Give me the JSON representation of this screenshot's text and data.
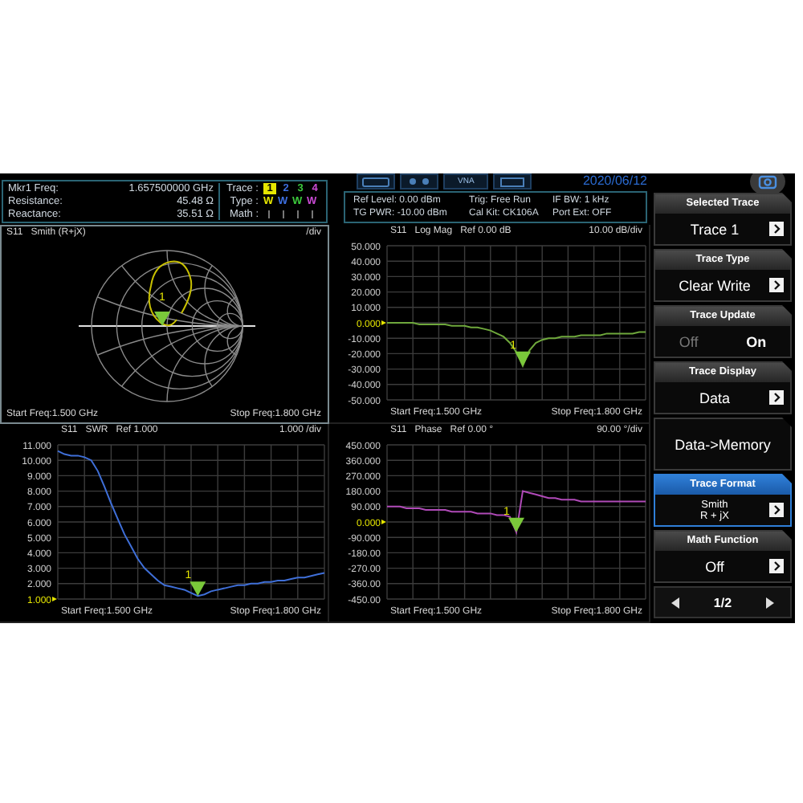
{
  "top_bar": {
    "mode": "VNA",
    "date": "2020/06/12"
  },
  "marker_info": [
    {
      "label": "Mkr1 Freq:",
      "value": "1.657500000 GHz"
    },
    {
      "label": "Resistance:",
      "value": "45.48 Ω"
    },
    {
      "label": "Reactance:",
      "value": "35.51 Ω"
    }
  ],
  "trace_info": {
    "trace_label": "Trace :",
    "type_label": "Type :",
    "math_label": "Math :",
    "traces": [
      {
        "number": "1",
        "type": "W",
        "color": "#e6e600",
        "selected": true
      },
      {
        "number": "2",
        "type": "W",
        "color": "#3d6fe0",
        "selected": false
      },
      {
        "number": "3",
        "type": "W",
        "color": "#3cc83c",
        "selected": false
      },
      {
        "number": "4",
        "type": "W",
        "color": "#c84ad2",
        "selected": false
      }
    ]
  },
  "settings": [
    "Ref Level: 0.00 dBm",
    "Trig: Free Run",
    "IF BW: 1 kHz",
    "TG PWR: -10.00 dBm",
    "Cal Kit: CK106A",
    "Port Ext: OFF"
  ],
  "panels": [
    {
      "kind": "smith",
      "parameter": "S11",
      "format": "Smith (R+jX)",
      "scale": "/div",
      "marker": "1",
      "start": "Start Freq:1.500 GHz",
      "stop": "Stop Freq:1.800 GHz"
    },
    {
      "kind": "line",
      "format": "Log Mag",
      "ref": "Ref 0.00 dB",
      "scale": "10.00  dB/div",
      "marker": "1",
      "ref_at_bottom": false,
      "start": "Start Freq:1.500 GHz",
      "stop": "Stop Freq:1.800 GHz",
      "chart_data": {
        "type": "line",
        "ylim": [
          -50,
          50
        ],
        "grid": true,
        "categories": [
          null,
          null,
          null,
          null,
          null,
          null,
          null,
          null,
          null,
          null,
          null,
          null,
          null,
          null,
          null,
          null,
          null,
          null,
          null,
          null,
          null,
          null,
          null,
          null,
          null,
          null,
          null,
          null,
          null,
          null,
          null,
          null,
          null,
          null,
          null,
          null,
          null,
          null,
          null,
          null,
          null
        ],
        "yticks": [
          {
            "value": 50,
            "label": "50.000"
          },
          {
            "value": 40,
            "label": "40.000"
          },
          {
            "value": 30,
            "label": "30.000"
          },
          {
            "value": 20,
            "label": "20.000"
          },
          {
            "value": 10,
            "label": "10.000"
          },
          {
            "value": 0,
            "label": "0.000"
          },
          {
            "value": -10,
            "label": "-10.000"
          },
          {
            "value": -20,
            "label": "-20.000"
          },
          {
            "value": -30,
            "label": "-30.000"
          },
          {
            "value": -40,
            "label": "-40.000"
          },
          {
            "value": -50,
            "label": "-50.000"
          }
        ],
        "series": [
          {
            "name": "S11",
            "color": "#6fa83c",
            "values": [
              0,
              0,
              0,
              0,
              0,
              -1,
              -1,
              -1,
              -1,
              -1,
              -2,
              -2,
              -2,
              -3,
              -3,
              -4,
              -5,
              -7,
              -9,
              -13,
              -19,
              -28,
              -18,
              -13,
              -11,
              -10,
              -10,
              -9,
              -9,
              -9,
              -8,
              -8,
              -8,
              -8,
              -7,
              -7,
              -7,
              -7,
              -7,
              -6,
              -6
            ]
          }
        ]
      }
    },
    {
      "kind": "line",
      "format": "SWR",
      "ref": "Ref 1.000",
      "scale": "1.000  /div",
      "marker": "1",
      "ref_at_bottom": true,
      "start": "Start Freq:1.500 GHz",
      "stop": "Stop Freq:1.800 GHz",
      "chart_data": {
        "type": "line",
        "ylim": [
          1,
          11
        ],
        "grid": true,
        "categories": [
          null,
          null,
          null,
          null,
          null,
          null,
          null,
          null,
          null,
          null,
          null,
          null,
          null,
          null,
          null,
          null,
          null,
          null,
          null,
          null,
          null,
          null,
          null,
          null,
          null,
          null,
          null,
          null,
          null,
          null,
          null,
          null,
          null,
          null,
          null,
          null,
          null,
          null,
          null,
          null,
          null
        ],
        "yticks": [
          {
            "value": 11,
            "label": "11.000"
          },
          {
            "value": 10,
            "label": "10.000"
          },
          {
            "value": 9,
            "label": "9.000"
          },
          {
            "value": 8,
            "label": "8.000"
          },
          {
            "value": 7,
            "label": "7.000"
          },
          {
            "value": 6,
            "label": "6.000"
          },
          {
            "value": 5,
            "label": "5.000"
          },
          {
            "value": 4,
            "label": "4.000"
          },
          {
            "value": 3,
            "label": "3.000"
          },
          {
            "value": 2,
            "label": "2.000"
          },
          {
            "value": 1,
            "label": "1.000"
          }
        ],
        "series": [
          {
            "name": "S11",
            "color": "#3f6fd8",
            "values": [
              10.6,
              10.4,
              10.3,
              10.3,
              10.2,
              10,
              9.3,
              8.3,
              7.2,
              6.2,
              5.2,
              4.4,
              3.6,
              3,
              2.6,
              2.2,
              1.9,
              1.8,
              1.7,
              1.6,
              1.4,
              1.2,
              1.3,
              1.5,
              1.6,
              1.7,
              1.8,
              1.9,
              1.9,
              2,
              2,
              2.1,
              2.1,
              2.2,
              2.2,
              2.3,
              2.4,
              2.4,
              2.5,
              2.6,
              2.7
            ]
          }
        ]
      }
    },
    {
      "kind": "line",
      "format": "Phase",
      "ref": "Ref 0.00 °",
      "scale": "90.00  °/div",
      "marker": "1",
      "ref_at_bottom": false,
      "start": "Start Freq:1.500 GHz",
      "stop": "Stop Freq:1.800 GHz",
      "chart_data": {
        "type": "line",
        "ylim": [
          -450,
          450
        ],
        "grid": true,
        "categories": [
          null,
          null,
          null,
          null,
          null,
          null,
          null,
          null,
          null,
          null,
          null,
          null,
          null,
          null,
          null,
          null,
          null,
          null,
          null,
          null,
          null,
          null,
          null,
          null,
          null,
          null,
          null,
          null,
          null,
          null,
          null,
          null,
          null,
          null,
          null,
          null,
          null,
          null,
          null,
          null,
          null
        ],
        "yticks": [
          {
            "value": 450,
            "label": "450.000"
          },
          {
            "value": 360,
            "label": "360.000"
          },
          {
            "value": 270,
            "label": "270.000"
          },
          {
            "value": 180,
            "label": "180.000"
          },
          {
            "value": 90,
            "label": "90.000"
          },
          {
            "value": 0,
            "label": "0.000"
          },
          {
            "value": -90,
            "label": "-90.000"
          },
          {
            "value": -180,
            "label": "-180.00"
          },
          {
            "value": -270,
            "label": "-270.00"
          },
          {
            "value": -360,
            "label": "-360.00"
          },
          {
            "value": -450,
            "label": "-450.00"
          }
        ],
        "series": [
          {
            "name": "S11",
            "color": "#b04ab8",
            "values": [
              90,
              90,
              90,
              80,
              80,
              80,
              70,
              70,
              70,
              70,
              60,
              60,
              60,
              60,
              50,
              50,
              50,
              40,
              40,
              30,
              -60,
              180,
              170,
              160,
              150,
              140,
              140,
              130,
              130,
              130,
              120,
              120,
              120,
              120,
              120,
              120,
              120,
              120,
              120,
              120,
              120
            ]
          }
        ]
      }
    }
  ],
  "sidebar": [
    {
      "kind": "menu",
      "title": "Selected Trace",
      "value": "Trace 1",
      "selected": false
    },
    {
      "kind": "menu",
      "title": "Trace Type",
      "value": "Clear Write",
      "selected": false
    },
    {
      "kind": "toggle",
      "title": "Trace Update",
      "options": [
        {
          "label": "Off",
          "selected": false
        },
        {
          "label": "On",
          "selected": true
        }
      ],
      "selected": false
    },
    {
      "kind": "menu",
      "title": "Trace Display",
      "value": "Data",
      "selected": false
    },
    {
      "kind": "action",
      "title": "Data->Memory",
      "selected": false
    },
    {
      "kind": "menu",
      "title": "Trace Format",
      "value_lines": [
        "Smith",
        "R + jX"
      ],
      "selected": true
    },
    {
      "kind": "menu",
      "title": "Math Function",
      "value": "Off",
      "selected": false
    },
    {
      "kind": "pager",
      "page": "1/2"
    }
  ]
}
